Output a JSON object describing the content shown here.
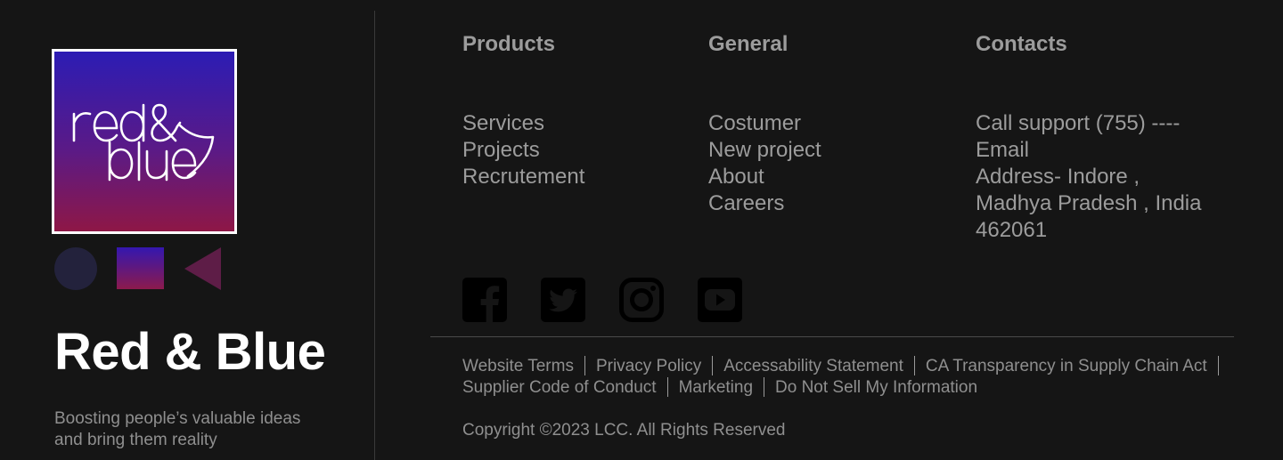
{
  "brand": {
    "logo_text": "red& blue",
    "name": "Red & Blue",
    "tagline": "Boosting people’s valuable ideas and bring them reality"
  },
  "colors": {
    "background": "#151515",
    "logo_gradient_top": "#2c1cb4",
    "logo_gradient_bottom": "#8e1746",
    "circle": "#23223c",
    "triangle": "#5e1d47",
    "text_muted": "#9a9a9a",
    "heading_white": "#ffffff"
  },
  "columns": {
    "products": {
      "heading": "Products",
      "items": [
        "Services",
        "Projects",
        "Recrutement"
      ]
    },
    "general": {
      "heading": "General",
      "items": [
        "Costumer",
        "New project",
        "About",
        "Careers"
      ]
    },
    "contacts": {
      "heading": "Contacts",
      "items": [
        "Call support (755) ----",
        "Email",
        "Address- Indore ,",
        "Madhya Pradesh , India",
        "462061"
      ]
    }
  },
  "social": [
    "facebook-icon",
    "twitter-icon",
    "instagram-icon",
    "youtube-icon"
  ],
  "legal_links": [
    "Website Terms",
    "Privacy Policy",
    "Accessability Statement",
    "CA Transparency in Supply Chain Act",
    "Supplier Code of Conduct",
    "Marketing",
    "Do Not Sell My Information"
  ],
  "copyright": "Copyright ©2023 LCC. All Rights Reserved"
}
